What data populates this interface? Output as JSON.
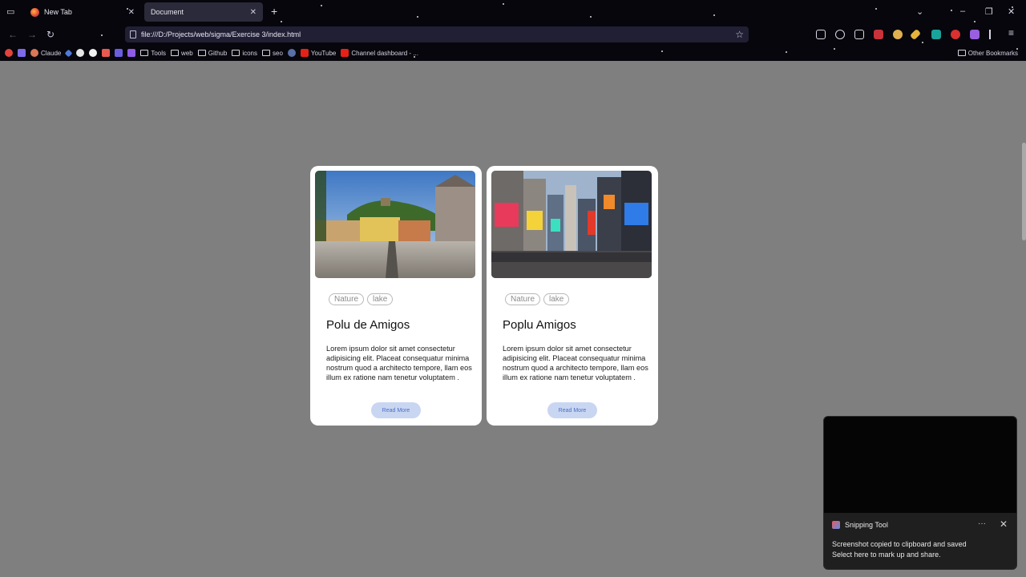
{
  "browser": {
    "tabs": [
      {
        "label": "New Tab"
      },
      {
        "label": "Document"
      }
    ],
    "url": "file:///D:/Projects/web/sigma/Exercise 3/index.html",
    "bookmarks": [
      {
        "label": "Claude"
      },
      {
        "label": "Tools"
      },
      {
        "label": "web"
      },
      {
        "label": "Github"
      },
      {
        "label": "icons"
      },
      {
        "label": "seo"
      },
      {
        "label": "YouTube"
      },
      {
        "label": "Channel dashboard - ..."
      }
    ],
    "other_bookmarks": "Other Bookmarks"
  },
  "cards": [
    {
      "tags": [
        "Nature",
        "lake"
      ],
      "title": "Polu de Amigos",
      "text": "Lorem ipsum dolor sit amet consectetur adipisicing elit. Placeat consequatur minima nostrum quod a architecto tempore, llam eos illum ex ratione nam tenetur voluptatem .",
      "button": "Read More"
    },
    {
      "tags": [
        "Nature",
        "lake"
      ],
      "title": "Poplu Amigos",
      "text": "Lorem ipsum dolor sit amet consectetur adipisicing elit. Placeat consequatur minima nostrum quod a architecto tempore, llam eos illum ex ratione nam tenetur voluptatem .",
      "button": "Read More"
    }
  ],
  "toast": {
    "app": "Snipping Tool",
    "more": "···",
    "close": "✕",
    "line1": "Screenshot copied to clipboard and saved",
    "line2": "Select here to mark up and share."
  },
  "colors": {
    "page_background": "#7f7f7f",
    "chrome_background": "#06060c",
    "button_background": "#c9d6f2",
    "button_text": "#4c6ec5"
  }
}
